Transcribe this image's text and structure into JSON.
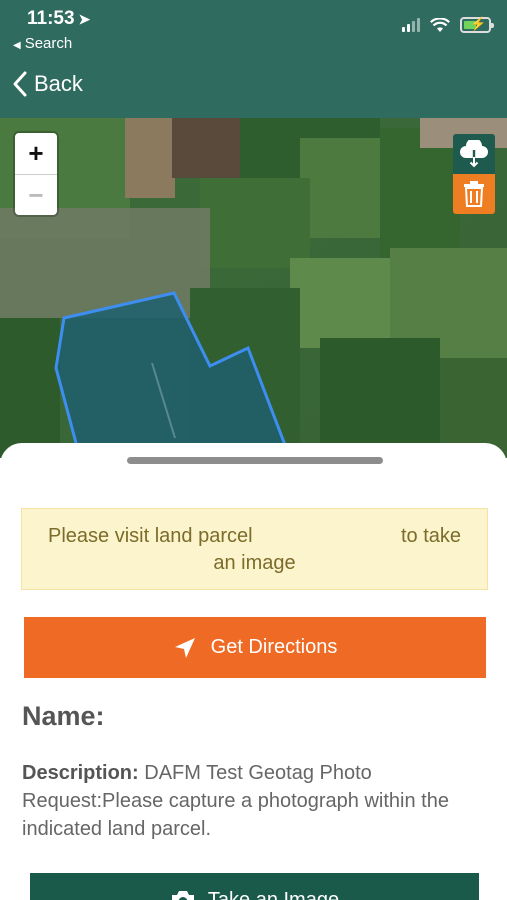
{
  "status_bar": {
    "time": "11:53",
    "back_to_app": "Search"
  },
  "header": {
    "back_label": "Back"
  },
  "map": {
    "zoom_in": "+",
    "zoom_out": "−"
  },
  "sheet": {
    "notice_line1": "Please visit land parcel",
    "notice_line1_end": "to take",
    "notice_line2": "an image",
    "directions_label": "Get Directions",
    "name_label": "Name:",
    "description_label": "Description:",
    "description_text": "DAFM Test Geotag Photo Request:Please capture a photograph within the indicated land parcel.",
    "take_image_label": "Take an Image"
  },
  "colors": {
    "header": "#2f6b5e",
    "directions": "#ef6a24",
    "take_image": "#1a5a4a",
    "notice_bg": "#fcf4cc",
    "trash": "#ef7d22"
  }
}
